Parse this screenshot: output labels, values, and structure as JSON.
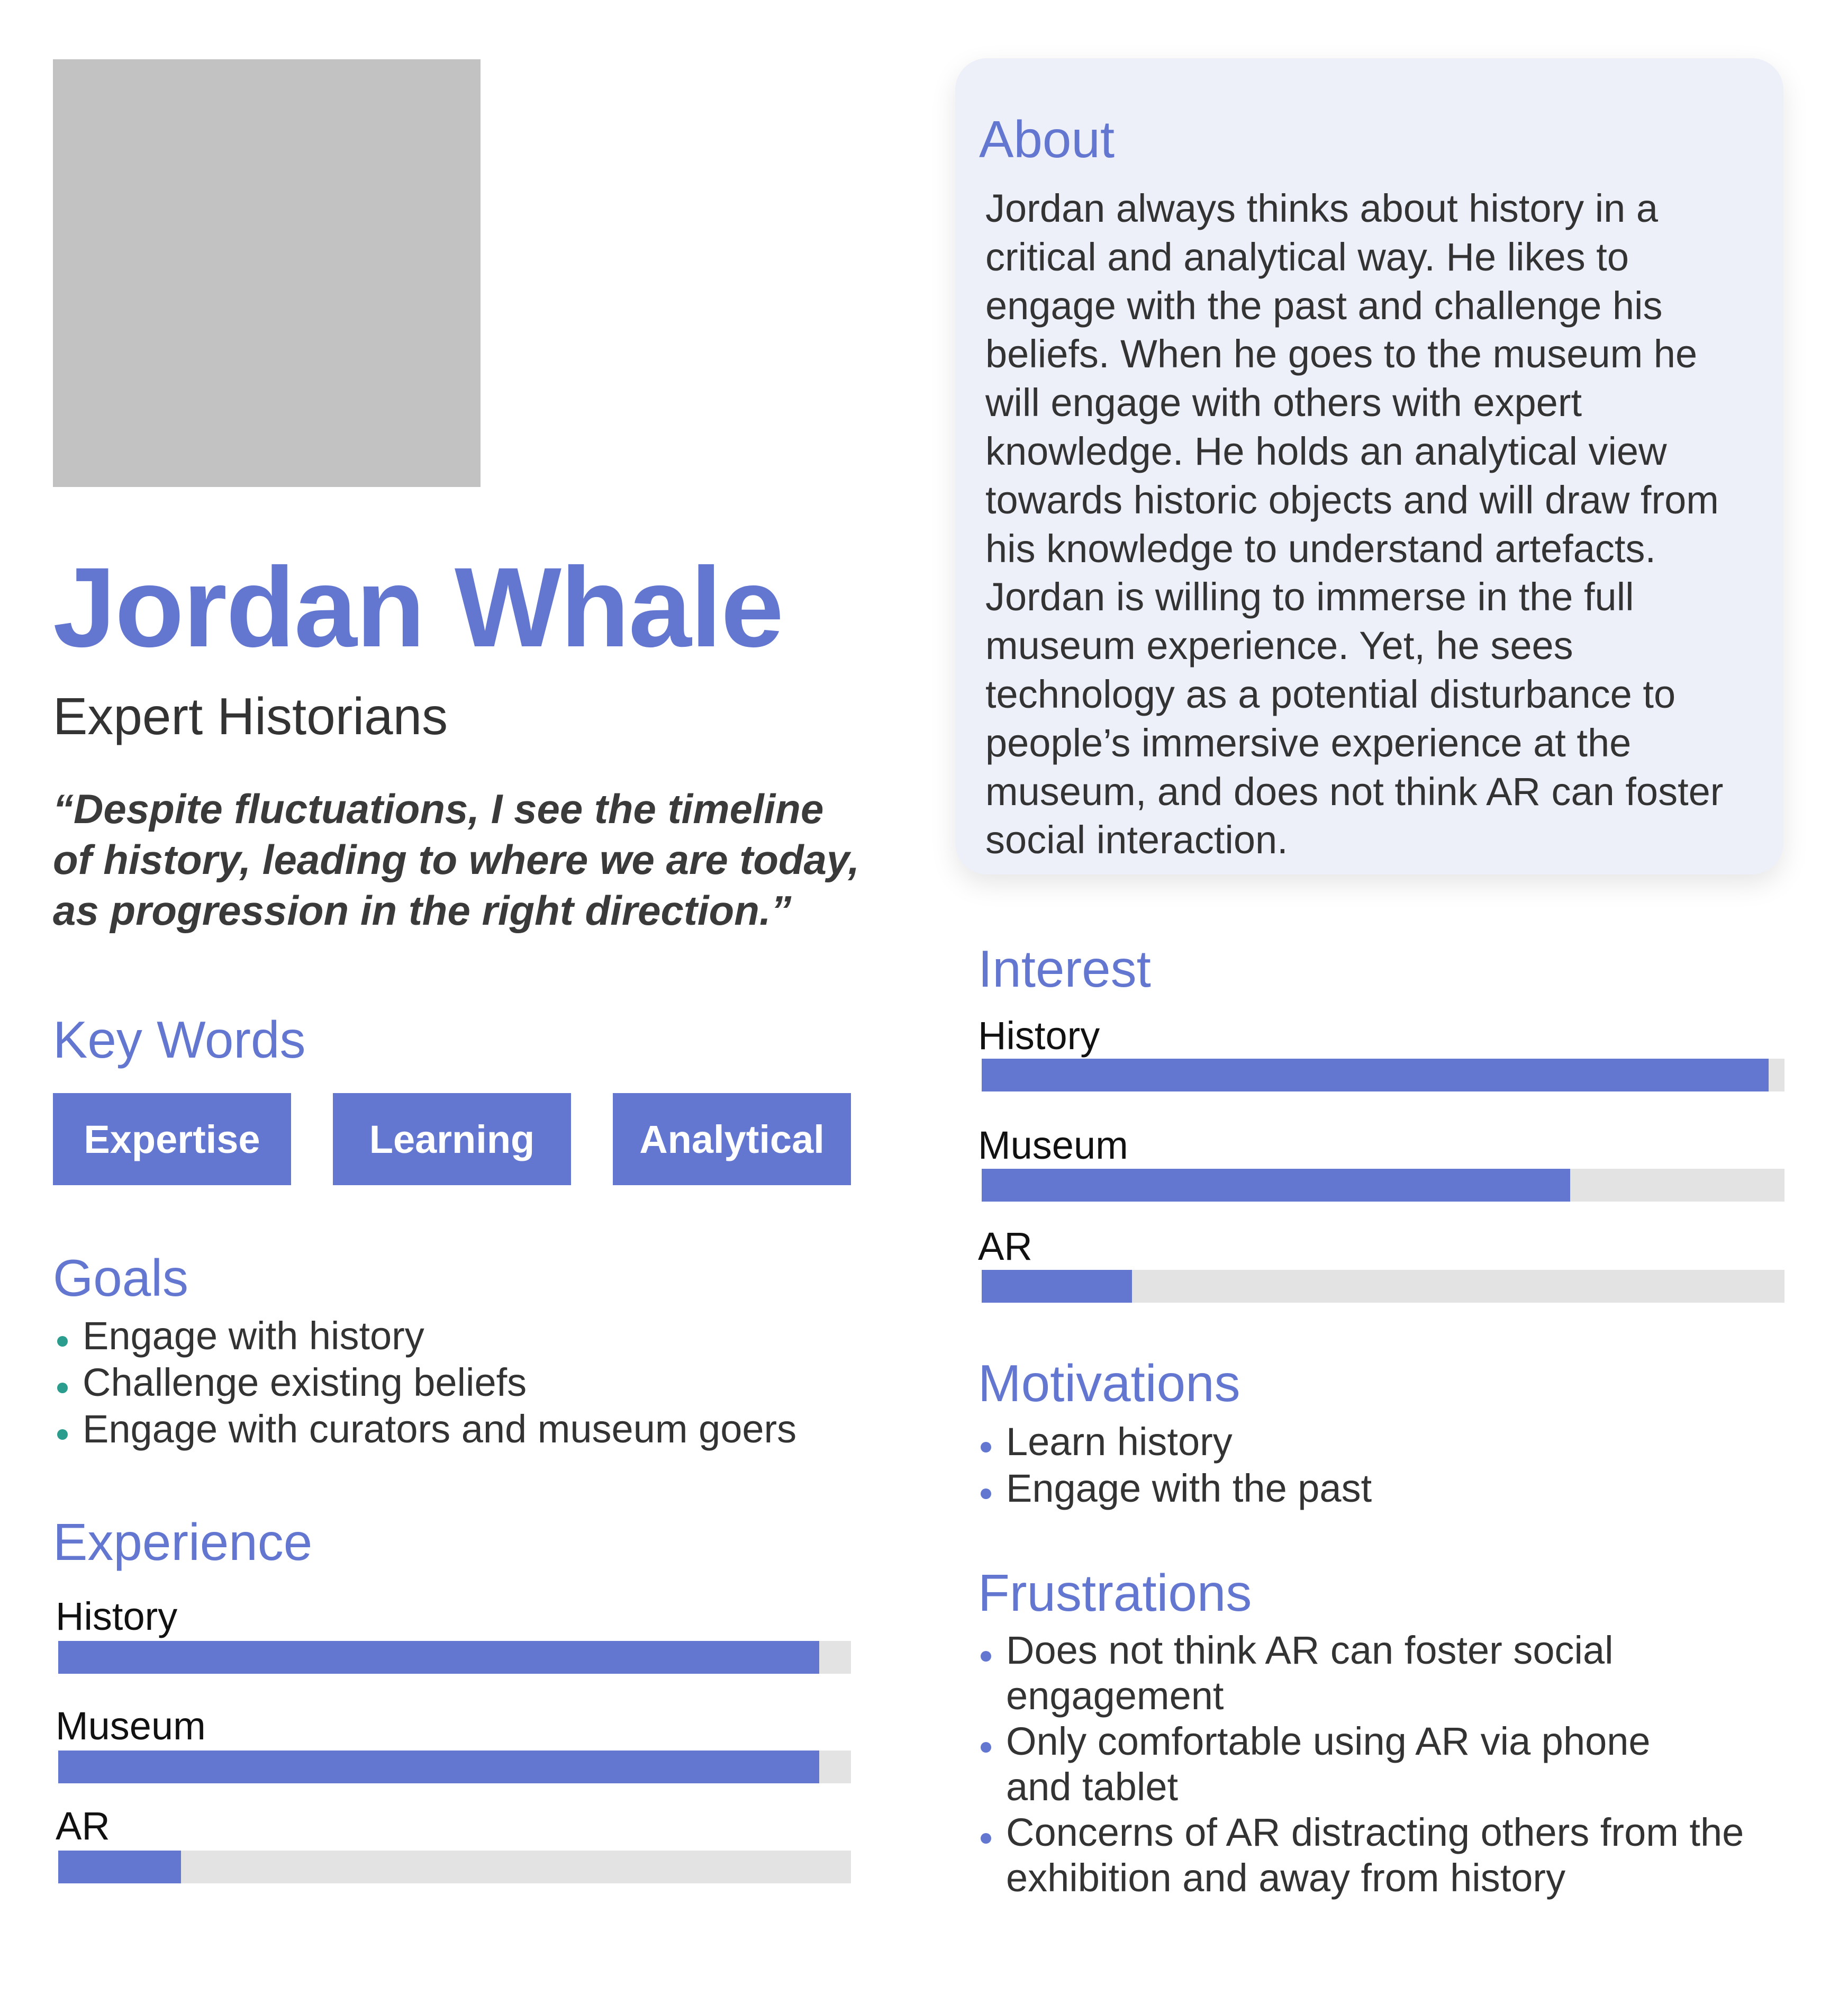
{
  "profile": {
    "name": "Jordan Whale",
    "role": "Expert Historians",
    "quote_lines": [
      "“Despite fluctuations, I see the timeline",
      "of history, leading to where we are today,",
      "as progression in the right direction.”"
    ]
  },
  "key_words": {
    "title": "Key Words",
    "items": [
      "Expertise",
      "Learning",
      "Analytical"
    ]
  },
  "goals": {
    "title": "Goals",
    "items": [
      "Engage with history",
      "Challenge existing beliefs",
      "Engage with curators and museum goers"
    ]
  },
  "experience": {
    "title": "Experience",
    "bars": [
      {
        "label": "History",
        "level": 0.96
      },
      {
        "label": "Museum",
        "level": 0.96
      },
      {
        "label": "AR",
        "level": 0.155
      }
    ]
  },
  "about": {
    "title": "About",
    "lines": [
      "Jordan always thinks about history in a",
      "critical and analytical way. He likes to",
      "engage with the past and challenge his",
      "beliefs. When he goes to the museum he",
      "will engage with others with expert",
      "knowledge. He holds an analytical view",
      "towards historic objects and will draw from",
      "his knowledge to understand artefacts.",
      "Jordan is willing to immerse in the full",
      "museum experience. Yet, he sees",
      "technology as a potential disturbance to",
      "people’s immersive experience at the",
      "museum, and does not think AR can foster",
      "social interaction."
    ]
  },
  "interest": {
    "title": "Interest",
    "bars": [
      {
        "label": "History",
        "level": 0.98
      },
      {
        "label": "Museum",
        "level": 0.733
      },
      {
        "label": "AR",
        "level": 0.187
      }
    ]
  },
  "motivations": {
    "title": "Motivations",
    "items": [
      "Learn history",
      "Engage with the past"
    ]
  },
  "frustrations": {
    "title": "Frustrations",
    "items": [
      [
        "Does not think AR can foster social",
        "engagement"
      ],
      [
        "Only comfortable using AR via phone",
        "and tablet"
      ],
      [
        "Concerns of AR distracting others from the",
        "exhibition and away from history"
      ]
    ]
  },
  "colors": {
    "accent": "#6377d1",
    "goal_bullet": "#2a9d8f",
    "track": "#e3e3e3",
    "card_bg": "#edeff9",
    "photo_placeholder": "#c2c2c2"
  }
}
